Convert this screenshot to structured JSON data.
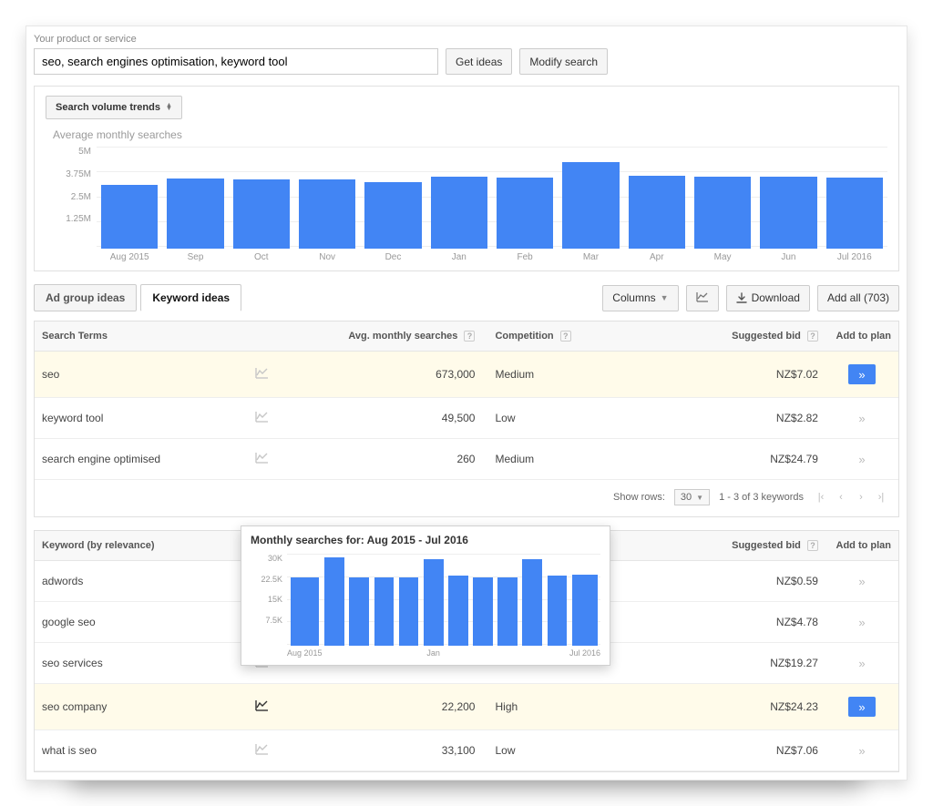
{
  "search": {
    "label": "Your product or service",
    "value": "seo, search engines optimisation, keyword tool",
    "get_ideas": "Get ideas",
    "modify_search": "Modify search"
  },
  "trend": {
    "dropdown_label": "Search volume trends",
    "chart_title": "Average monthly searches"
  },
  "chart_data": {
    "type": "bar",
    "title": "Average monthly searches",
    "xlabel": "",
    "ylabel": "",
    "ylim": [
      0,
      5000000
    ],
    "y_ticks": [
      "5M",
      "3.75M",
      "2.5M",
      "1.25M"
    ],
    "categories": [
      "Aug 2015",
      "Sep",
      "Oct",
      "Nov",
      "Dec",
      "Jan",
      "Feb",
      "Mar",
      "Apr",
      "May",
      "Jun",
      "Jul 2016"
    ],
    "values": [
      3200000,
      3500000,
      3450000,
      3450000,
      3300000,
      3600000,
      3550000,
      4300000,
      3650000,
      3600000,
      3600000,
      3550000
    ]
  },
  "tabs": {
    "ad_group": "Ad group ideas",
    "keyword": "Keyword ideas"
  },
  "toolbar": {
    "columns": "Columns",
    "download": "Download",
    "add_all": "Add all (703)"
  },
  "search_terms": {
    "headers": {
      "term": "Search Terms",
      "searches": "Avg. monthly searches",
      "competition": "Competition",
      "bid": "Suggested bid",
      "add": "Add to plan"
    },
    "rows": [
      {
        "term": "seo",
        "searches": "673,000",
        "competition": "Medium",
        "bid": "NZ$7.02",
        "highlight": true,
        "addable": true
      },
      {
        "term": "keyword tool",
        "searches": "49,500",
        "competition": "Low",
        "bid": "NZ$2.82",
        "highlight": false,
        "addable": false
      },
      {
        "term": "search engine optimised",
        "searches": "260",
        "competition": "Medium",
        "bid": "NZ$24.79",
        "highlight": false,
        "addable": false
      }
    ]
  },
  "pager": {
    "show_rows": "Show rows:",
    "rows_value": "30",
    "summary": "1 - 3 of 3 keywords"
  },
  "keyword_ideas": {
    "headers": {
      "keyword": "Keyword (by relevance)",
      "bid": "Suggested bid",
      "add": "Add to plan"
    },
    "rows": [
      {
        "term": "adwords",
        "searches": "",
        "competition": "",
        "bid": "NZ$0.59",
        "highlight": false,
        "addable": false,
        "activeChart": false
      },
      {
        "term": "google seo",
        "searches": "",
        "competition": "",
        "bid": "NZ$4.78",
        "highlight": false,
        "addable": false,
        "activeChart": false
      },
      {
        "term": "seo services",
        "searches": "",
        "competition": "",
        "bid": "NZ$19.27",
        "highlight": false,
        "addable": false,
        "activeChart": false
      },
      {
        "term": "seo company",
        "searches": "22,200",
        "competition": "High",
        "bid": "NZ$24.23",
        "highlight": true,
        "addable": true,
        "activeChart": true
      },
      {
        "term": "what is seo",
        "searches": "33,100",
        "competition": "Low",
        "bid": "NZ$7.06",
        "highlight": false,
        "addable": false,
        "activeChart": false
      }
    ]
  },
  "tooltip": {
    "title": "Monthly searches for: Aug 2015 - Jul 2016",
    "chart_data": {
      "type": "bar",
      "ylim": [
        0,
        30000
      ],
      "y_ticks": [
        "30K",
        "22.5K",
        "15K",
        "7.5K"
      ],
      "categories": [
        "Aug 2015",
        "",
        "",
        "",
        "",
        "Jan",
        "",
        "",
        "",
        "",
        "",
        "Jul 2016"
      ],
      "values": [
        22500,
        29000,
        22500,
        22500,
        22500,
        28500,
        23000,
        22500,
        22500,
        28500,
        23000,
        23500
      ]
    }
  }
}
